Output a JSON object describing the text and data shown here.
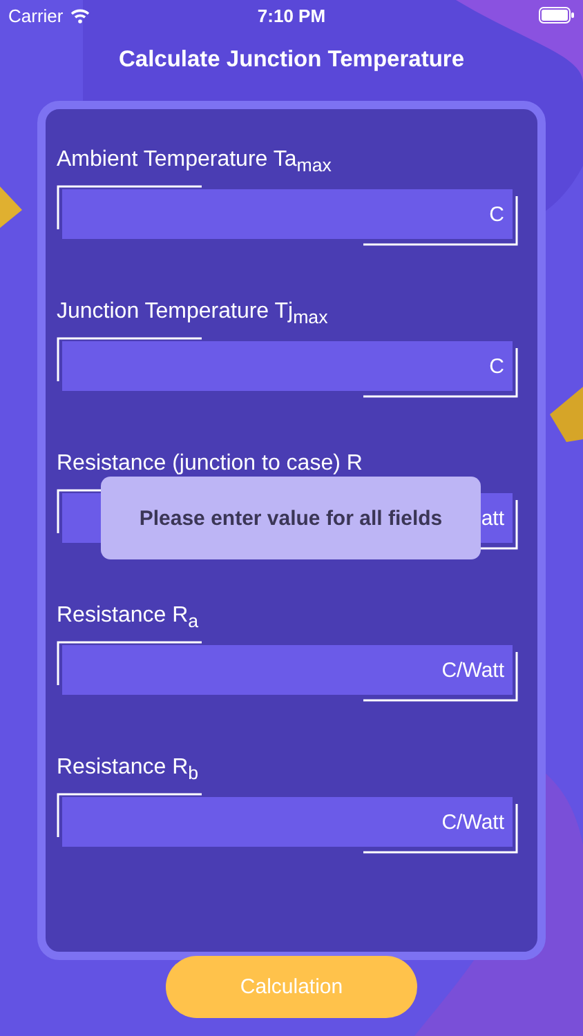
{
  "status_bar": {
    "carrier": "Carrier",
    "time": "7:10 PM"
  },
  "title": "Calculate Junction Temperature",
  "fields": [
    {
      "label": "Ambient Temperature Ta$_{max}$",
      "unit": "C"
    },
    {
      "label": "Junction Temperature Tj$_{max}$",
      "unit": "C"
    },
    {
      "label": "Resistance (junction to case) R",
      "unit": "att"
    },
    {
      "label": "Resistance R$_{a}$",
      "unit": "C/Watt"
    },
    {
      "label": "Resistance R$_{b}$",
      "unit": "C/Watt"
    }
  ],
  "toast": "Please enter value for all fields",
  "button": "Calculation"
}
